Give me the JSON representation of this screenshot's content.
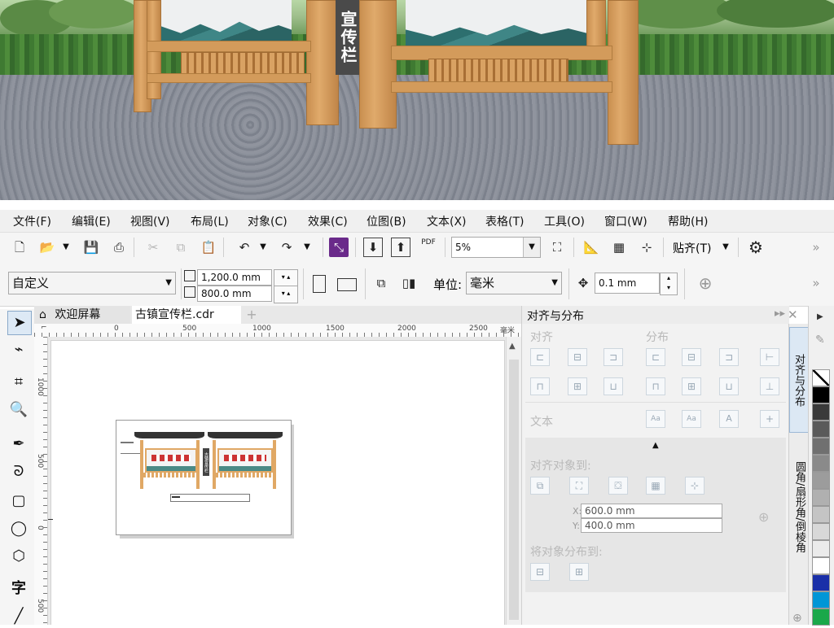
{
  "preview": {
    "sign_text": "宣传栏"
  },
  "menu": [
    "文件(F)",
    "编辑(E)",
    "视图(V)",
    "布局(L)",
    "对象(C)",
    "效果(C)",
    "位图(B)",
    "文本(X)",
    "表格(T)",
    "工具(O)",
    "窗口(W)",
    "帮助(H)"
  ],
  "toolbar": {
    "zoom": "5%",
    "snap_label": "贴齐(T)",
    "pdf_label": "PDF"
  },
  "propbar": {
    "page_preset": "自定义",
    "width": "1,200.0 mm",
    "height": "800.0 mm",
    "unit_label": "单位:",
    "unit_value": "毫米",
    "nudge": "0.1 mm"
  },
  "tabs": {
    "welcome": "欢迎屏幕",
    "document": "古镇宣传栏.cdr",
    "add": "+"
  },
  "ruler": {
    "h_ticks": [
      "0",
      "500",
      "1000",
      "1500",
      "2000",
      "2500"
    ],
    "unit": "毫米",
    "v_ticks": [
      "1000",
      "500",
      "0",
      "500"
    ]
  },
  "thumbnail": {
    "sign_text": "古镇宣传栏"
  },
  "docker": {
    "title": "对齐与分布",
    "align_label": "对齐",
    "distribute_label": "分布",
    "text_label": "文本",
    "align_to_label": "对齐对象到:",
    "x_value": "600.0 mm",
    "y_value": "400.0 mm",
    "x_prefix": "X:",
    "y_prefix": "Y:",
    "distribute_to_label": "将对象分布到:"
  },
  "side_tabs": [
    "对齐与分布",
    "圆角/扇形角/倒棱角"
  ],
  "palette": [
    "#ffffff",
    "#000000",
    "#3a3a3a",
    "#5a5a5a",
    "#707070",
    "#8a8a8a",
    "#9c9c9c",
    "#b0b0b0",
    "#c4c4c4",
    "#d8d8d8",
    "#ebebeb",
    "#ffffff",
    "#1a2fa8",
    "#0096d6",
    "#1aa84a"
  ]
}
